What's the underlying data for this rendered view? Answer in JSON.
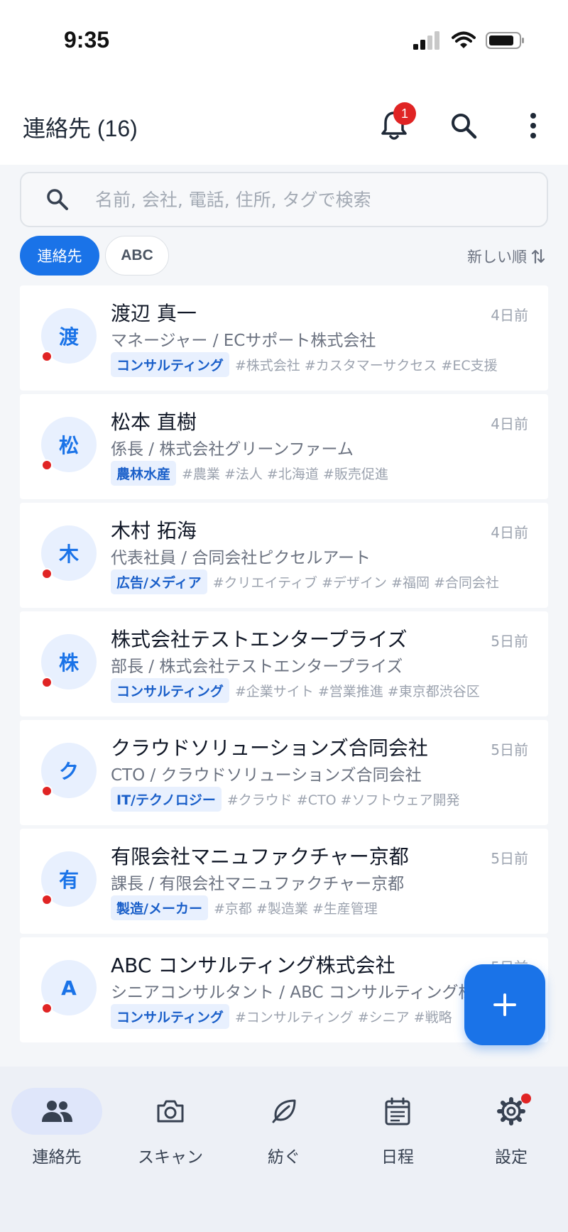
{
  "status": {
    "time": "9:35"
  },
  "header": {
    "title": "連絡先 (16)",
    "notification_count": "1"
  },
  "search": {
    "placeholder": "名前, 会社, 電話, 住所, タグで検索"
  },
  "filters": {
    "active": "連絡先",
    "inactive": "ABC"
  },
  "sort": {
    "label": "新しい順"
  },
  "contacts": [
    {
      "initial": "渡",
      "name": "渡辺 真一",
      "time": "4日前",
      "role": "マネージャー / ECサポート株式会社",
      "category": "コンサルティング",
      "tags": "#株式会社 #カスタマーサクセス #EC支援"
    },
    {
      "initial": "松",
      "name": "松本 直樹",
      "time": "4日前",
      "role": "係長 / 株式会社グリーンファーム",
      "category": "農林水産",
      "tags": "#農業 #法人 #北海道 #販売促進"
    },
    {
      "initial": "木",
      "name": "木村 拓海",
      "time": "4日前",
      "role": "代表社員 / 合同会社ピクセルアート",
      "category": "広告/メディア",
      "tags": "#クリエイティブ #デザイン #福岡 #合同会社"
    },
    {
      "initial": "株",
      "name": "株式会社テストエンタープライズ",
      "time": "5日前",
      "role": "部長 / 株式会社テストエンタープライズ",
      "category": "コンサルティング",
      "tags": "#企業サイト #営業推進 #東京都渋谷区"
    },
    {
      "initial": "ク",
      "name": "クラウドソリューションズ合同会社",
      "time": "5日前",
      "role": "CTO / クラウドソリューションズ合同会社",
      "category": "IT/テクノロジー",
      "tags": "#クラウド #CTO #ソフトウェア開発"
    },
    {
      "initial": "有",
      "name": "有限会社マニュファクチャー京都",
      "time": "5日前",
      "role": "課長 / 有限会社マニュファクチャー京都",
      "category": "製造/メーカー",
      "tags": "#京都 #製造業 #生産管理"
    },
    {
      "initial": "A",
      "name": "ABC コンサルティング株式会社",
      "time": "5日前",
      "role": "シニアコンサルタント / ABC コンサルティング株式会社",
      "category": "コンサルティング",
      "tags": "#コンサルティング #シニア #戦略"
    }
  ],
  "nav": [
    {
      "label": "連絡先",
      "icon": "people-icon"
    },
    {
      "label": "スキャン",
      "icon": "camera-icon"
    },
    {
      "label": "紡ぐ",
      "icon": "leaf-icon"
    },
    {
      "label": "日程",
      "icon": "calendar-icon"
    },
    {
      "label": "設定",
      "icon": "gear-icon"
    }
  ],
  "colors": {
    "accent": "#1a73e8",
    "badge": "#e02424"
  }
}
